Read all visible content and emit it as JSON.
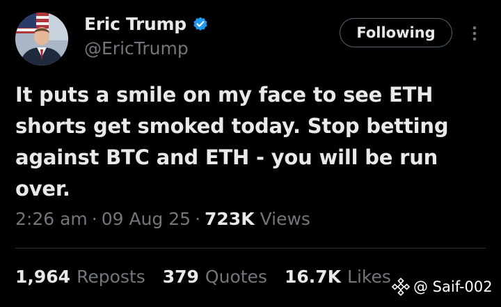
{
  "author": {
    "display_name": "Eric Trump",
    "handle": "@EricTrump",
    "verified": true
  },
  "follow_button": {
    "label": "Following"
  },
  "tweet": {
    "text": "It puts a smile on my face to see ETH shorts get smoked today. Stop betting against BTC and ETH - you will be run over.",
    "time": "2:26 am",
    "date": "09 Aug 25",
    "views_count": "723K",
    "views_label": "Views",
    "separator": "·"
  },
  "stats": {
    "reposts_count": "1,964",
    "reposts_label": "Reposts",
    "quotes_count": "379",
    "quotes_label": "Quotes",
    "likes_count": "16.7K",
    "likes_label": "Likes"
  },
  "watermark": {
    "text": "@ Saif-002",
    "icon": "binance-icon"
  },
  "colors": {
    "background": "#000000",
    "text_primary": "#e7e9ea",
    "text_secondary": "#71767b",
    "verified": "#1d9bf0",
    "border": "#536471"
  }
}
